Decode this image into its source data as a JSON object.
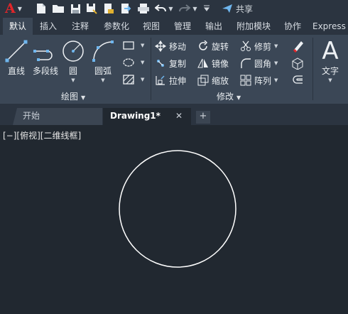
{
  "quick_access": {
    "logo_letter": "A",
    "share_label": "共享"
  },
  "ribbon_tabs": [
    {
      "label": "默认",
      "active": true
    },
    {
      "label": "插入"
    },
    {
      "label": "注释"
    },
    {
      "label": "参数化"
    },
    {
      "label": "视图"
    },
    {
      "label": "管理"
    },
    {
      "label": "输出"
    },
    {
      "label": "附加模块"
    },
    {
      "label": "协作"
    },
    {
      "label": "Express"
    }
  ],
  "draw_panel": {
    "title": "绘图",
    "line_label": "直线",
    "polyline_label": "多段线",
    "circle_label": "圆",
    "arc_label": "圆弧"
  },
  "modify_panel": {
    "title": "修改",
    "move_label": "移动",
    "rotate_label": "旋转",
    "trim_label": "修剪",
    "copy_label": "复制",
    "mirror_label": "镜像",
    "fillet_label": "圆角",
    "stretch_label": "拉伸",
    "scale_label": "缩放",
    "array_label": "阵列"
  },
  "annotation_panel": {
    "text_label": "文字"
  },
  "file_tabs": {
    "start_label": "开始",
    "doc_label": "Drawing1*",
    "close_symbol": "✕",
    "new_symbol": "+"
  },
  "viewport": {
    "label": "[−][俯视][二维线框]"
  },
  "colors": {
    "accent_red": "#e0262a",
    "ribbon_bg": "#3b4756",
    "canvas_bg": "#212830",
    "icon_blue": "#6fb6ee"
  }
}
